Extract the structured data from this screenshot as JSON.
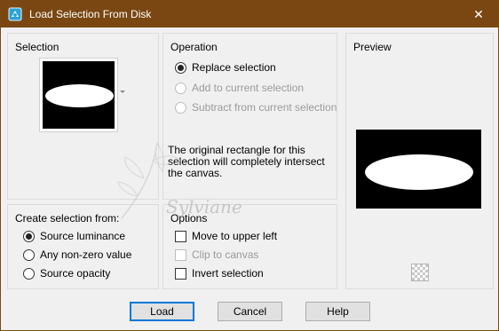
{
  "window": {
    "title": "Load Selection From Disk",
    "close_glyph": "✕",
    "frame_color": "#7a4712"
  },
  "selection_group": {
    "label": "Selection"
  },
  "operation_group": {
    "label": "Operation",
    "options": [
      {
        "label": "Replace selection",
        "checked": true,
        "enabled": true
      },
      {
        "label": "Add to current selection",
        "checked": false,
        "enabled": false
      },
      {
        "label": "Subtract from current selection",
        "checked": false,
        "enabled": false
      }
    ],
    "info": "The original rectangle for this selection will completely intersect the canvas."
  },
  "preview_group": {
    "label": "Preview",
    "checker_icon": "transparency-checker-icon"
  },
  "create_from_group": {
    "label": "Create selection from:",
    "options": [
      {
        "label": "Source luminance",
        "checked": true
      },
      {
        "label": "Any non-zero value",
        "checked": false
      },
      {
        "label": "Source opacity",
        "checked": false
      }
    ]
  },
  "options_group": {
    "label": "Options",
    "checks": [
      {
        "label": "Move to upper left",
        "checked": false,
        "enabled": true
      },
      {
        "label": "Clip to canvas",
        "checked": false,
        "enabled": false
      },
      {
        "label": "Invert selection",
        "checked": false,
        "enabled": true
      }
    ]
  },
  "buttons": {
    "load": "Load",
    "cancel": "Cancel",
    "help": "Help"
  },
  "watermark": {
    "text": "Sylviane"
  }
}
